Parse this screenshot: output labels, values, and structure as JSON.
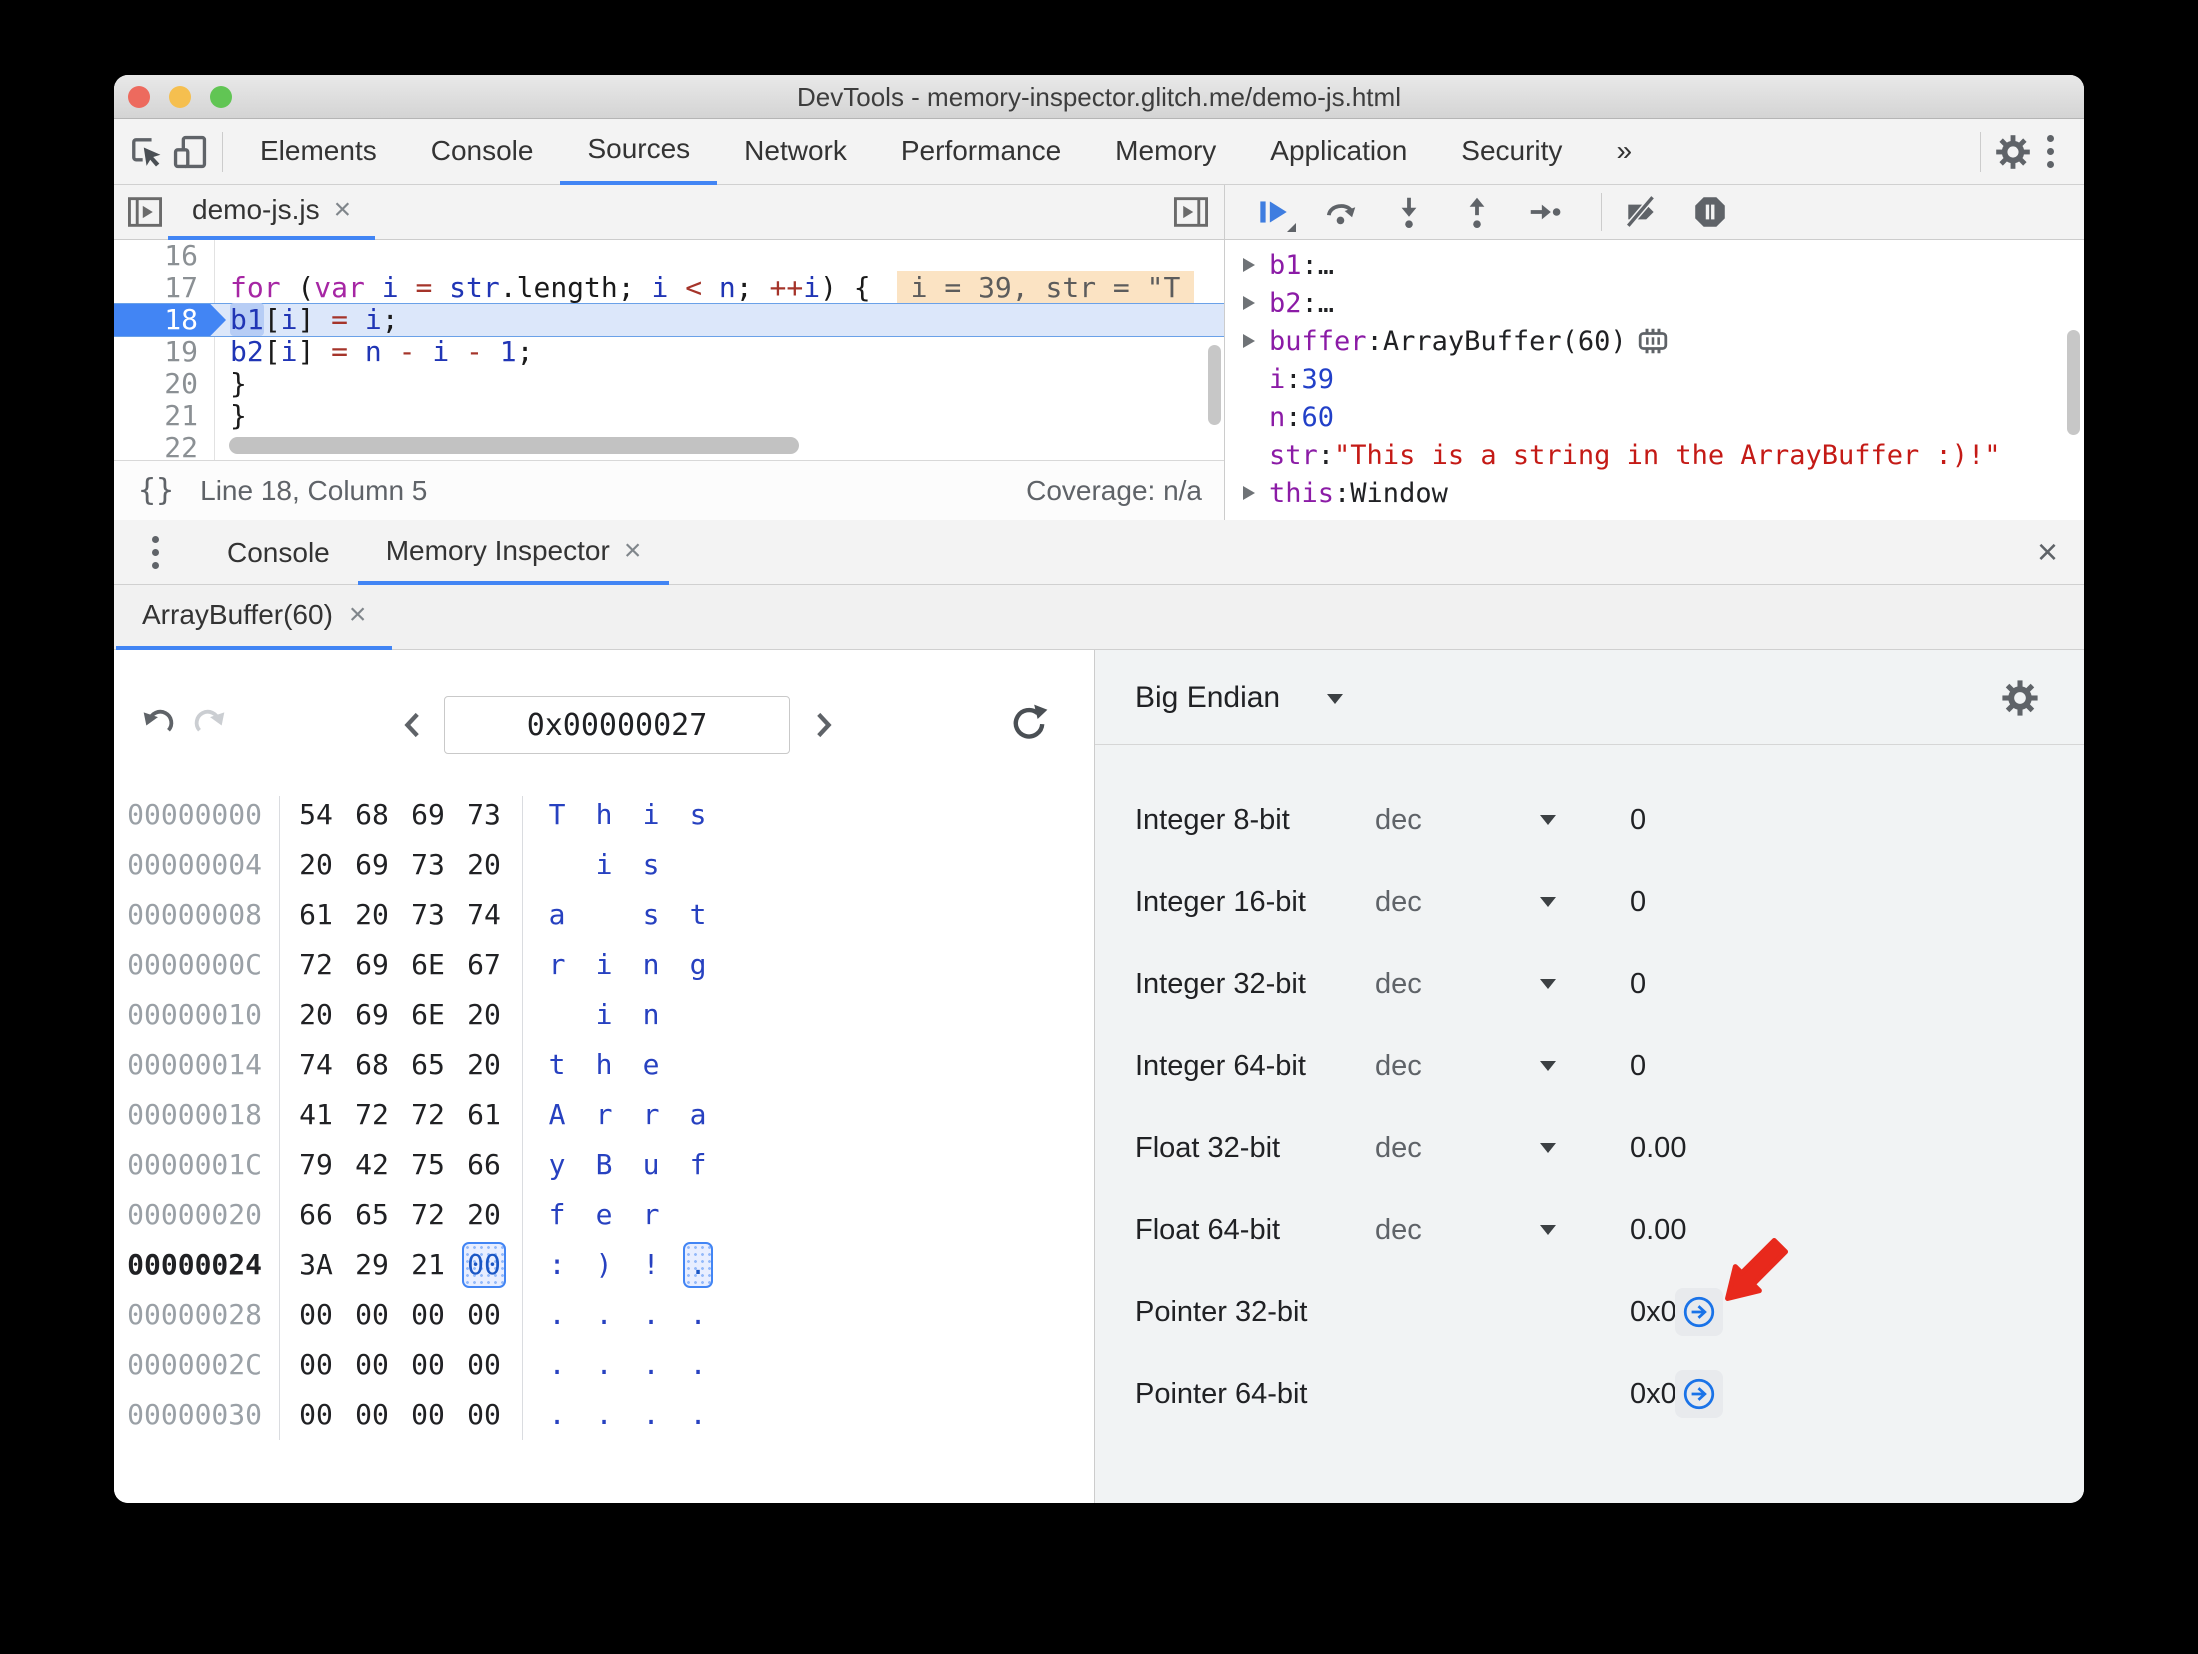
{
  "window": {
    "title": "DevTools - memory-inspector.glitch.me/demo-js.html"
  },
  "colors": {
    "accent_blue": "#4285f4",
    "jump_icon_blue": "#1a73e8",
    "annotation_red": "#e8291c",
    "ascii_blue": "#2741c0",
    "string_red": "#c41a16",
    "number_blue": "#2240c8",
    "property_purple": "#8b1ba6",
    "keyword_purple": "#a626a4",
    "operator_red": "#a5342a"
  },
  "toolbar": {
    "tabs": [
      {
        "label": "Elements"
      },
      {
        "label": "Console"
      },
      {
        "label": "Sources",
        "active": true
      },
      {
        "label": "Network"
      },
      {
        "label": "Performance"
      },
      {
        "label": "Memory"
      },
      {
        "label": "Application"
      },
      {
        "label": "Security"
      },
      {
        "label": "»",
        "overflow": true
      }
    ]
  },
  "sources": {
    "file_tab": {
      "label": "demo-js.js",
      "close": "×"
    },
    "code_lines": [
      {
        "num": "16",
        "tokens": []
      },
      {
        "num": "17",
        "tokens": [
          [
            "pln",
            "  "
          ],
          [
            "kw",
            "for"
          ],
          [
            "pln",
            " ("
          ],
          [
            "kw",
            "var"
          ],
          [
            "pln",
            " "
          ],
          [
            "vr",
            "i"
          ],
          [
            "pln",
            " "
          ],
          [
            "op",
            "="
          ],
          [
            "pln",
            " "
          ],
          [
            "vr",
            "str"
          ],
          [
            "pln",
            ".length; "
          ],
          [
            "vr",
            "i"
          ],
          [
            "pln",
            " "
          ],
          [
            "op",
            "<"
          ],
          [
            "pln",
            " "
          ],
          [
            "vr",
            "n"
          ],
          [
            "pln",
            "; "
          ],
          [
            "op",
            "++"
          ],
          [
            "vr",
            "i"
          ],
          [
            "pln",
            ") {"
          ]
        ],
        "hint": "i = 39, str = \"T"
      },
      {
        "num": "18",
        "current": true,
        "tokens": [
          [
            "pln",
            "    "
          ],
          [
            "vr-sel",
            "b1"
          ],
          [
            "pln",
            "["
          ],
          [
            "vr",
            "i"
          ],
          [
            "pln",
            "] "
          ],
          [
            "op",
            "="
          ],
          [
            "pln",
            " "
          ],
          [
            "vr",
            "i"
          ],
          [
            "pln",
            ";"
          ]
        ]
      },
      {
        "num": "19",
        "tokens": [
          [
            "pln",
            "    "
          ],
          [
            "vr",
            "b2"
          ],
          [
            "pln",
            "["
          ],
          [
            "vr",
            "i"
          ],
          [
            "pln",
            "] "
          ],
          [
            "op",
            "="
          ],
          [
            "pln",
            " "
          ],
          [
            "vr",
            "n"
          ],
          [
            "pln",
            " "
          ],
          [
            "op",
            "-"
          ],
          [
            "pln",
            " "
          ],
          [
            "vr",
            "i"
          ],
          [
            "pln",
            " "
          ],
          [
            "op",
            "-"
          ],
          [
            "pln",
            " "
          ],
          [
            "num",
            "1"
          ],
          [
            "pln",
            ";"
          ]
        ]
      },
      {
        "num": "20",
        "tokens": [
          [
            "pln",
            "  }"
          ]
        ]
      },
      {
        "num": "21",
        "tokens": [
          [
            "pln",
            "}"
          ]
        ]
      },
      {
        "num": "22",
        "tokens": []
      }
    ],
    "status": {
      "braces": "{}",
      "position": "Line 18, Column 5",
      "coverage": "Coverage: n/a"
    }
  },
  "debugger": {
    "scope": [
      {
        "expand": true,
        "name": "b1",
        "sep": ": ",
        "value": "…",
        "vtype": "plain"
      },
      {
        "expand": true,
        "name": "b2",
        "sep": ": ",
        "value": "…",
        "vtype": "plain"
      },
      {
        "expand": true,
        "name": "buffer",
        "sep": ": ",
        "value": "ArrayBuffer(60)",
        "vtype": "plain",
        "chip_icon": true
      },
      {
        "expand": false,
        "name": "i",
        "sep": ": ",
        "value": "39",
        "vtype": "number"
      },
      {
        "expand": false,
        "name": "n",
        "sep": ": ",
        "value": "60",
        "vtype": "number"
      },
      {
        "expand": false,
        "name": "str",
        "sep": ": ",
        "value": "\"This is a string in the ArrayBuffer :)!\"",
        "vtype": "string"
      },
      {
        "expand": true,
        "name": "this",
        "sep": ": ",
        "value": "Window",
        "vtype": "plain"
      }
    ]
  },
  "drawer": {
    "tabs": [
      {
        "label": "Console"
      },
      {
        "label": "Memory Inspector",
        "active": true,
        "close": "×"
      }
    ],
    "close": "×"
  },
  "memory_inspector": {
    "buffer_tab": {
      "label": "ArrayBuffer(60)",
      "close": "×"
    },
    "navigation": {
      "address": "0x00000027"
    },
    "endianness": "Big Endian",
    "hex_rows": [
      {
        "addr": "00000000",
        "bytes": [
          "54",
          "68",
          "69",
          "73"
        ],
        "ascii": [
          "T",
          "h",
          "i",
          "s"
        ]
      },
      {
        "addr": "00000004",
        "bytes": [
          "20",
          "69",
          "73",
          "20"
        ],
        "ascii": [
          " ",
          "i",
          "s",
          " "
        ]
      },
      {
        "addr": "00000008",
        "bytes": [
          "61",
          "20",
          "73",
          "74"
        ],
        "ascii": [
          "a",
          " ",
          "s",
          "t"
        ]
      },
      {
        "addr": "0000000C",
        "bytes": [
          "72",
          "69",
          "6E",
          "67"
        ],
        "ascii": [
          "r",
          "i",
          "n",
          "g"
        ]
      },
      {
        "addr": "00000010",
        "bytes": [
          "20",
          "69",
          "6E",
          "20"
        ],
        "ascii": [
          " ",
          "i",
          "n",
          " "
        ]
      },
      {
        "addr": "00000014",
        "bytes": [
          "74",
          "68",
          "65",
          "20"
        ],
        "ascii": [
          "t",
          "h",
          "e",
          " "
        ]
      },
      {
        "addr": "00000018",
        "bytes": [
          "41",
          "72",
          "72",
          "61"
        ],
        "ascii": [
          "A",
          "r",
          "r",
          "a"
        ]
      },
      {
        "addr": "0000001C",
        "bytes": [
          "79",
          "42",
          "75",
          "66"
        ],
        "ascii": [
          "y",
          "B",
          "u",
          "f"
        ]
      },
      {
        "addr": "00000020",
        "bytes": [
          "66",
          "65",
          "72",
          "20"
        ],
        "ascii": [
          "f",
          "e",
          "r",
          " "
        ]
      },
      {
        "addr": "00000024",
        "bytes": [
          "3A",
          "29",
          "21",
          "00"
        ],
        "ascii": [
          ":",
          ")",
          "!",
          "."
        ],
        "current": true,
        "selected_byte": 3
      },
      {
        "addr": "00000028",
        "bytes": [
          "00",
          "00",
          "00",
          "00"
        ],
        "ascii": [
          ".",
          ".",
          ".",
          "."
        ]
      },
      {
        "addr": "0000002C",
        "bytes": [
          "00",
          "00",
          "00",
          "00"
        ],
        "ascii": [
          ".",
          ".",
          ".",
          "."
        ]
      },
      {
        "addr": "00000030",
        "bytes": [
          "00",
          "00",
          "00",
          "00"
        ],
        "ascii": [
          ".",
          ".",
          ".",
          "."
        ]
      }
    ],
    "interpretations": [
      {
        "label": "Integer 8-bit",
        "mode": "dec",
        "value": "0"
      },
      {
        "label": "Integer 16-bit",
        "mode": "dec",
        "value": "0"
      },
      {
        "label": "Integer 32-bit",
        "mode": "dec",
        "value": "0"
      },
      {
        "label": "Integer 64-bit",
        "mode": "dec",
        "value": "0"
      },
      {
        "label": "Float 32-bit",
        "mode": "dec",
        "value": "0.00"
      },
      {
        "label": "Float 64-bit",
        "mode": "dec",
        "value": "0.00"
      },
      {
        "label": "Pointer 32-bit",
        "value": "0x0",
        "jump": true,
        "arrow_annotation": true
      },
      {
        "label": "Pointer 64-bit",
        "value": "0x0",
        "jump": true
      }
    ]
  }
}
